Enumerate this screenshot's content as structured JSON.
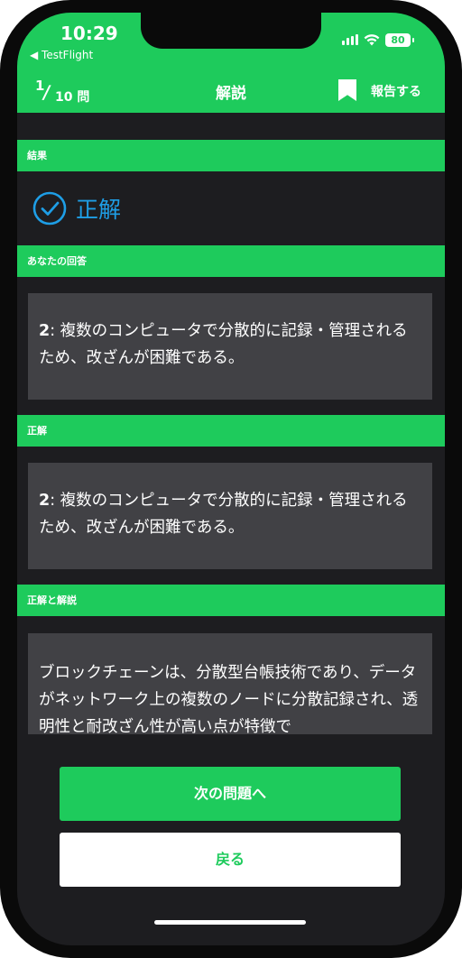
{
  "status_bar": {
    "time": "10:29",
    "back_app": "◀ TestFlight",
    "battery": "80"
  },
  "nav": {
    "counter_current": "1",
    "counter_total": "10 問",
    "title": "解説",
    "report_label": "報告する",
    "bookmark_icon": "bookmark-icon"
  },
  "sections": {
    "result_label": "結果",
    "your_answer_label": "あなたの回答",
    "correct_label": "正解",
    "explanation_label": "正解と解説"
  },
  "result": {
    "text": "正解",
    "icon": "check-circle-icon"
  },
  "your_answer": {
    "number": "2",
    "text": ": 複数のコンピュータで分散的に記録・管理されるため、改ざんが困難である。"
  },
  "correct_answer": {
    "number": "2",
    "text": ": 複数のコンピュータで分散的に記録・管理されるため、改ざんが困難である。"
  },
  "explanation": {
    "text": "ブロックチェーンは、分散型台帳技術であり、データがネットワーク上の複数のノードに分散記録され、透明性と耐改ざん性が高い点が特徴で"
  },
  "buttons": {
    "next": "次の問題へ",
    "back": "戻る"
  },
  "colors": {
    "accent": "#1ecb5c",
    "result_blue": "#1e9ee6",
    "background": "#1d1d20",
    "card": "#414145"
  }
}
